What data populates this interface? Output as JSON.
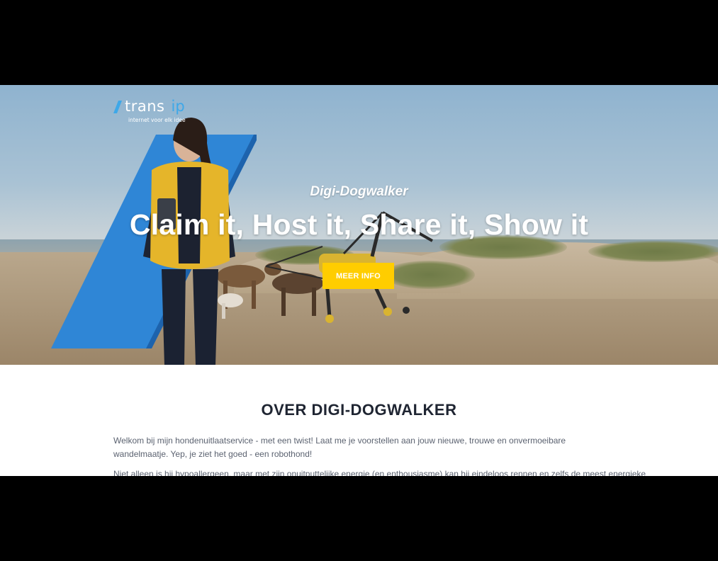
{
  "logo": {
    "brand_main": "trans",
    "brand_accent": "ip",
    "tagline": "internet voor elk idee",
    "accent_color": "#3ea8e8"
  },
  "hero": {
    "subtitle": "Digi-Dogwalker",
    "title": "Claim it, Host it, Share it, Show it",
    "cta_label": "MEER INFO",
    "cta_color": "#ffcd00",
    "panel_color": "#2f86d6"
  },
  "about": {
    "title": "OVER DIGI-DOGWALKER",
    "paragraph_1": "Welkom bij mijn hondenuitlaatservice - met een twist! Laat me je voorstellen aan jouw nieuwe, trouwe en onvermoeibare wandelmaatje. Yep, je ziet het goed - een robothond!",
    "paragraph_2": "Niet alleen is hij hypoallergeen, maar met zijn onuitputtelijke energie (en enthousiasme) kan hij eindeloos rennen en zelfs de meest energieke"
  }
}
